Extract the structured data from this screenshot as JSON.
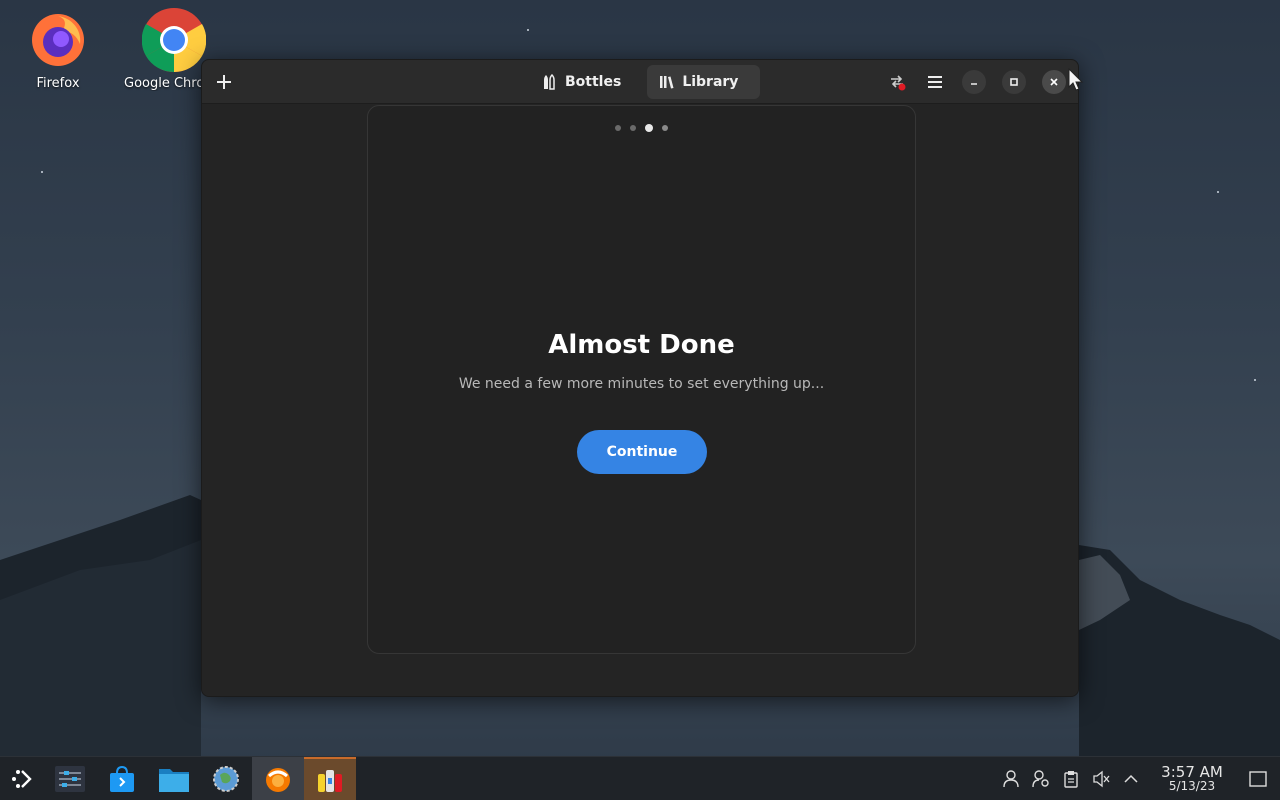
{
  "desktop": {
    "icons": [
      {
        "label": "Firefox"
      },
      {
        "label": "Google Chrome"
      }
    ]
  },
  "window": {
    "tabs": [
      {
        "label": "Bottles",
        "active": false
      },
      {
        "label": "Library",
        "active": true
      }
    ],
    "onboarding": {
      "page_count": 4,
      "current_page": 3,
      "title": "Almost Done",
      "subtitle": "We need a few more minutes to set everything up...",
      "continue_label": "Continue"
    }
  },
  "taskbar": {
    "clock": {
      "time": "3:57 AM",
      "date": "5/13/23"
    }
  },
  "colors": {
    "accent": "#3584e4",
    "window_bg": "#242424",
    "headerbar_bg": "#2b2b2b"
  }
}
